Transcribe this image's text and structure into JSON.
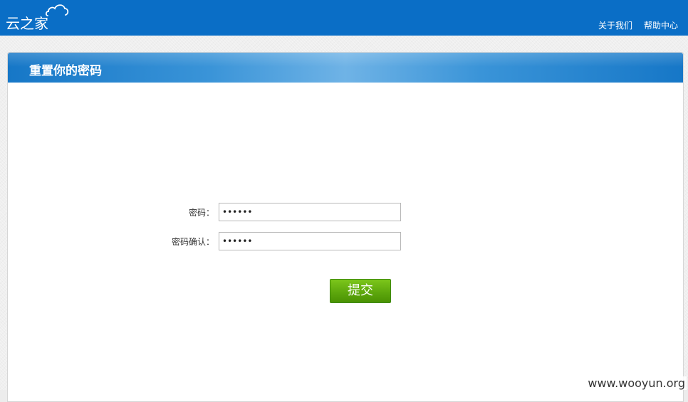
{
  "brand": {
    "logo_text": "云之家",
    "logo_icon": "cloud-icon"
  },
  "top_nav": {
    "about": "关于我们",
    "help": "帮助中心"
  },
  "panel": {
    "title": "重置你的密码"
  },
  "form": {
    "password_label": "密码：",
    "password_value": "123456",
    "confirm_label": "密码确认：",
    "confirm_value": "123456",
    "submit_label": "提交"
  },
  "watermark": "www.wooyun.org",
  "colors": {
    "topbar": "#0a6ec6",
    "submit": "#5ea80d"
  }
}
